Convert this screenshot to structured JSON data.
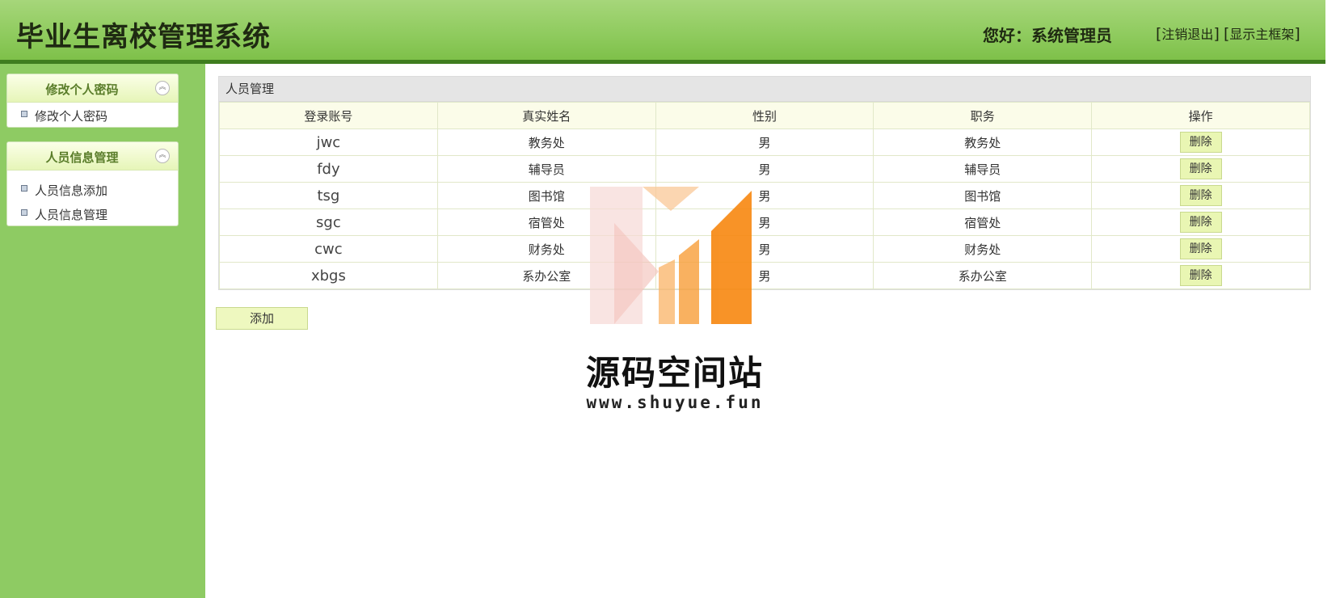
{
  "header": {
    "title": "毕业生离校管理系统",
    "greeting": "您好：系统管理员",
    "logout_label": "注销退出",
    "main_frame_label": "显示主框架"
  },
  "sidebar": {
    "groups": [
      {
        "title": "修改个人密码",
        "items": [
          {
            "label": "修改个人密码"
          }
        ]
      },
      {
        "title": "人员信息管理",
        "items": [
          {
            "label": "人员信息添加"
          },
          {
            "label": "人员信息管理"
          }
        ]
      }
    ]
  },
  "main": {
    "panel_title": "人员管理",
    "columns": [
      "登录账号",
      "真实姓名",
      "性别",
      "职务",
      "操作"
    ],
    "rows": [
      {
        "account": "jwc",
        "name": "教务处",
        "gender": "男",
        "position": "教务处",
        "action": "删除"
      },
      {
        "account": "fdy",
        "name": "辅导员",
        "gender": "男",
        "position": "辅导员",
        "action": "删除"
      },
      {
        "account": "tsg",
        "name": "图书馆",
        "gender": "男",
        "position": "图书馆",
        "action": "删除"
      },
      {
        "account": "sgc",
        "name": "宿管处",
        "gender": "男",
        "position": "宿管处",
        "action": "删除"
      },
      {
        "account": "cwc",
        "name": "财务处",
        "gender": "男",
        "position": "财务处",
        "action": "删除"
      },
      {
        "account": "xbgs",
        "name": "系办公室",
        "gender": "男",
        "position": "系办公室",
        "action": "删除"
      }
    ],
    "add_label": "添加"
  },
  "watermark": {
    "text": "源码空间站",
    "url": "www.shuyue.fun"
  },
  "colors": {
    "header_green": "#8fcb5e",
    "header_line": "#3f7d1f",
    "sidebar_green": "#8ecb63",
    "button_bg": "#e9f6b3",
    "watermark_orange": "#f7870f"
  },
  "icons": {
    "collapse": "double-chevron-up-icon",
    "bullet": "square-bullet-icon"
  }
}
